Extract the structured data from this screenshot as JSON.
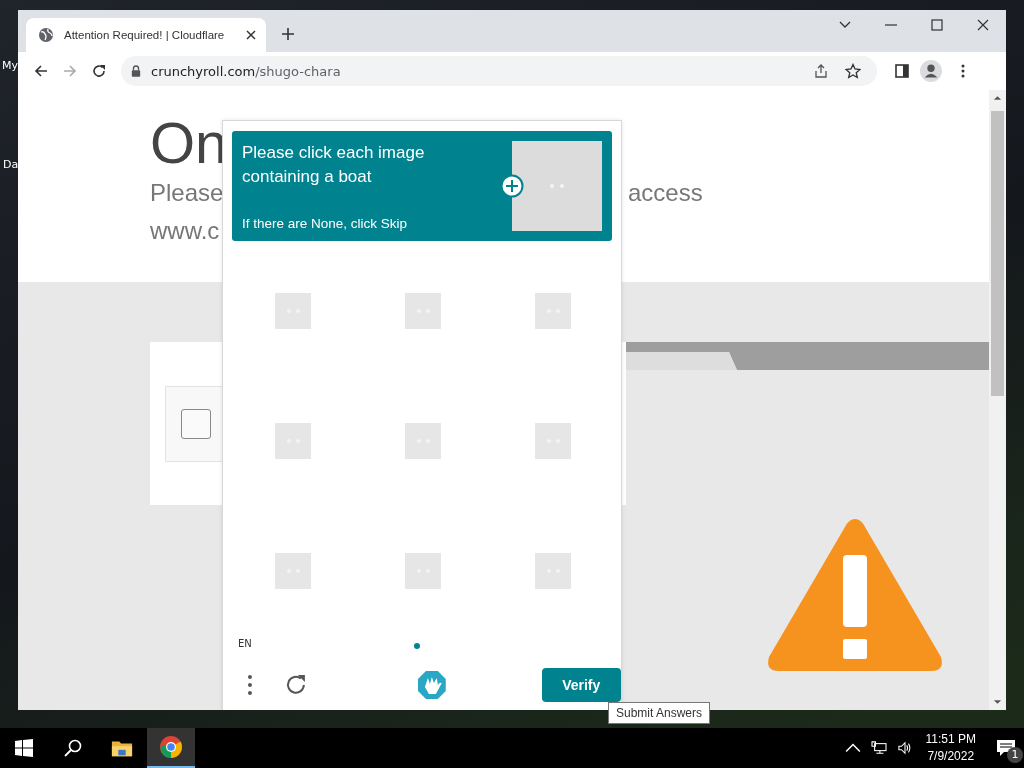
{
  "desktop": {
    "icon_labels": [
      "My",
      "Da"
    ]
  },
  "browser": {
    "tab": {
      "title": "Attention Required! | Cloudflare"
    },
    "address": {
      "domain": "crunchyroll.com",
      "path": "/shugo-chara"
    }
  },
  "page": {
    "heading": "On",
    "subtitle_start": "Please",
    "subtitle_end": "access",
    "url_fragment": "www.c",
    "checkbox": {
      "checked": false
    }
  },
  "captcha": {
    "prompt": "Please click each image containing a boat",
    "hint": "If there are None, click Skip",
    "tiles": [
      {
        "selected": false
      },
      {
        "selected": false
      },
      {
        "selected": false
      },
      {
        "selected": false
      },
      {
        "selected": false
      },
      {
        "selected": false
      },
      {
        "selected": false
      },
      {
        "selected": false
      },
      {
        "selected": false
      }
    ],
    "language": "EN",
    "verify_button": "Verify",
    "tooltip": "Submit Answers"
  },
  "taskbar": {
    "time": "11:51 PM",
    "date": "7/9/2022",
    "notification_count": "1"
  }
}
